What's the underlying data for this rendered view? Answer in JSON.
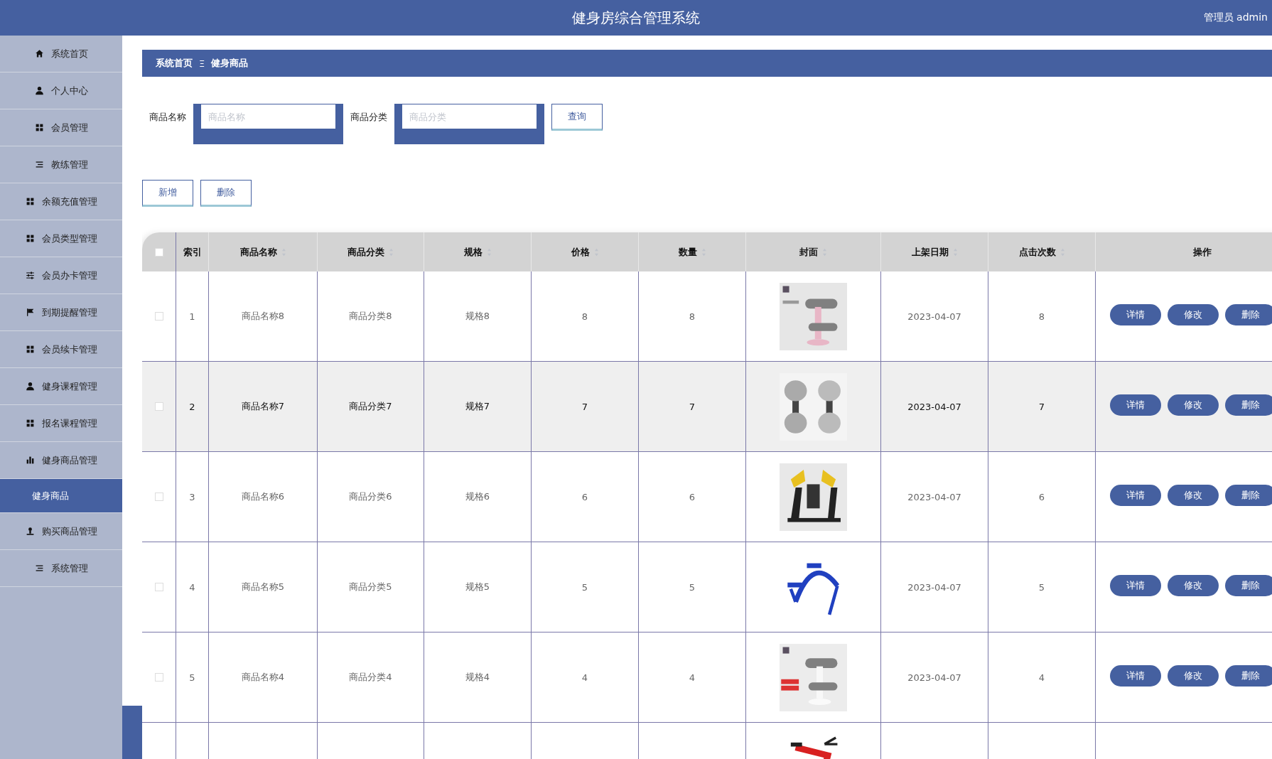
{
  "header": {
    "title": "健身房综合管理系统",
    "user": "管理员 admin"
  },
  "sidebar": {
    "items": [
      {
        "label": "系统首页",
        "kind": "home",
        "selected": false
      },
      {
        "label": "个人中心",
        "kind": "user",
        "selected": false
      },
      {
        "label": "会员管理",
        "kind": "grid",
        "selected": false
      },
      {
        "label": "教练管理",
        "kind": "list",
        "selected": false
      },
      {
        "label": "余额充值管理",
        "kind": "grid",
        "selected": false
      },
      {
        "label": "会员类型管理",
        "kind": "grid",
        "selected": false
      },
      {
        "label": "会员办卡管理",
        "kind": "sliders",
        "selected": false
      },
      {
        "label": "到期提醒管理",
        "kind": "flag",
        "selected": false
      },
      {
        "label": "会员续卡管理",
        "kind": "grid",
        "selected": false
      },
      {
        "label": "健身课程管理",
        "kind": "user",
        "selected": false
      },
      {
        "label": "报名课程管理",
        "kind": "grid",
        "selected": false
      },
      {
        "label": "健身商品管理",
        "kind": "chart",
        "selected": false,
        "children": [
          {
            "label": "健身商品",
            "selected": true
          }
        ]
      },
      {
        "label": "购买商品管理",
        "kind": "person",
        "selected": false
      },
      {
        "label": "系统管理",
        "kind": "list",
        "selected": false
      }
    ]
  },
  "breadcrumb": {
    "items": [
      "系统首页",
      "健身商品"
    ],
    "separator": "Ξ"
  },
  "search": {
    "fields": [
      {
        "label": "商品名称",
        "placeholder": "商品名称"
      },
      {
        "label": "商品分类",
        "placeholder": "商品分类"
      }
    ],
    "button": "查询"
  },
  "actions": [
    "新增",
    "删除"
  ],
  "table": {
    "header_checkbox": {
      "checked": false
    },
    "columns": [
      {
        "label": "索引",
        "sortable": false
      },
      {
        "label": "商品名称",
        "sortable": true
      },
      {
        "label": "商品分类",
        "sortable": true
      },
      {
        "label": "规格",
        "sortable": true
      },
      {
        "label": "价格",
        "sortable": true
      },
      {
        "label": "数量",
        "sortable": true
      },
      {
        "label": "封面",
        "sortable": true
      },
      {
        "label": "上架日期",
        "sortable": true
      },
      {
        "label": "点击次数",
        "sortable": true
      },
      {
        "label": "操作",
        "sortable": false
      }
    ],
    "rows": [
      {
        "checked": false,
        "highlighted": false,
        "index": "1",
        "name": "商品名称8",
        "category": "商品分类8",
        "spec": "规格8",
        "price": "8",
        "quantity": "8",
        "date": "2023-04-07",
        "clicks": "8",
        "buttons": [
          "详情",
          "修改",
          "删除"
        ]
      },
      {
        "checked": false,
        "highlighted": true,
        "index": "2",
        "name": "商品名称7",
        "category": "商品分类7",
        "spec": "规格7",
        "price": "7",
        "quantity": "7",
        "date": "2023-04-07",
        "clicks": "7",
        "buttons": [
          "详情",
          "修改",
          "删除"
        ]
      },
      {
        "checked": false,
        "highlighted": false,
        "index": "3",
        "name": "商品名称6",
        "category": "商品分类6",
        "spec": "规格6",
        "price": "6",
        "quantity": "6",
        "date": "2023-04-07",
        "clicks": "6",
        "buttons": [
          "详情",
          "修改",
          "删除"
        ]
      },
      {
        "checked": false,
        "highlighted": false,
        "index": "4",
        "name": "商品名称5",
        "category": "商品分类5",
        "spec": "规格5",
        "price": "5",
        "quantity": "5",
        "date": "2023-04-07",
        "clicks": "5",
        "buttons": [
          "详情",
          "修改",
          "删除"
        ]
      },
      {
        "checked": false,
        "highlighted": false,
        "index": "5",
        "name": "商品名称4",
        "category": "商品分类4",
        "spec": "规格4",
        "price": "4",
        "quantity": "4",
        "date": "2023-04-07",
        "clicks": "4",
        "buttons": [
          "详情",
          "修改",
          "删除"
        ]
      }
    ]
  }
}
